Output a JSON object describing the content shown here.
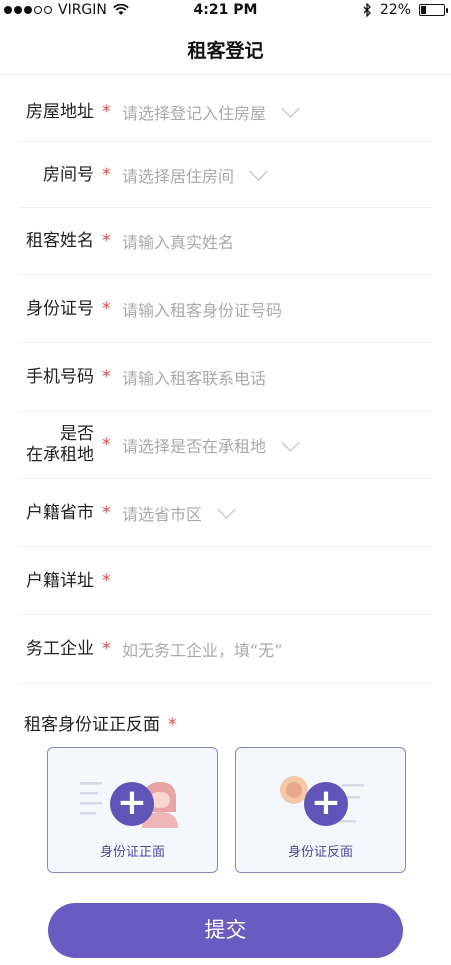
{
  "status_bar": {
    "carrier": "VIRGIN",
    "time": "4:21 PM",
    "battery": "22%",
    "battery_level": 0.22
  },
  "nav": {
    "title": "租客登记"
  },
  "form": {
    "fields": [
      {
        "label": "房屋地址",
        "required": "*",
        "placeholder": "请选择登记入住房屋",
        "type": "select"
      },
      {
        "label": "房间号",
        "required": "*",
        "placeholder": "请选择居住房间",
        "type": "select"
      },
      {
        "label": "租客姓名",
        "required": "*",
        "placeholder": "请输入真实姓名",
        "type": "input"
      },
      {
        "label": "身份证号",
        "required": "*",
        "placeholder": "请输入租客身份证号码",
        "type": "input"
      },
      {
        "label": "手机号码",
        "required": "*",
        "placeholder": "请输入租客联系电话",
        "type": "input"
      },
      {
        "label_line1": "是否",
        "label_line2": "在承租地",
        "required": "*",
        "placeholder": "请选择是否在承租地",
        "type": "select"
      },
      {
        "label": "户籍省市",
        "required": "*",
        "placeholder": "请选省市区",
        "type": "select"
      },
      {
        "label": "户籍详址",
        "required": "*",
        "placeholder": "",
        "type": "input"
      },
      {
        "label": "务工企业",
        "required": "*",
        "placeholder": "如无务工企业，填“无”",
        "type": "input"
      }
    ]
  },
  "id_photos": {
    "label": "租客身份证正反面",
    "required": "*",
    "front_caption": "身份证正面",
    "back_caption": "身份证反面",
    "plus": "+",
    "icon": "plus-circle-icon"
  },
  "submit": {
    "label": "提交"
  },
  "colors": {
    "accent": "#6a5bc1",
    "required": "#e54848",
    "placeholder": "#aaaaaa",
    "card_border": "#8a86c0"
  }
}
